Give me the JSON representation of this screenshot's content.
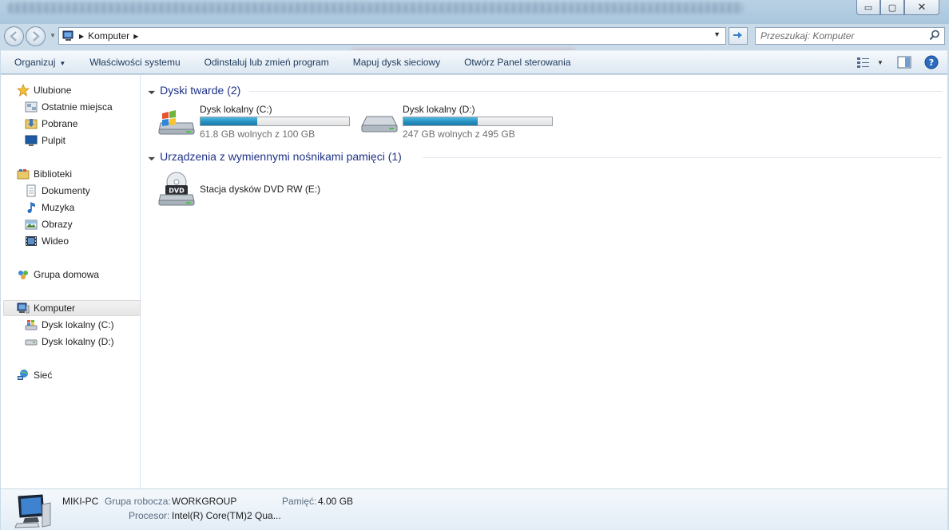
{
  "window": {
    "minimize_label": "▭",
    "maximize_label": "▢",
    "close_label": "✕"
  },
  "address": {
    "breadcrumb": "Komputer"
  },
  "search": {
    "placeholder": "Przeszukaj: Komputer"
  },
  "toolbar": {
    "organize": "Organizuj",
    "system_properties": "Właściwości systemu",
    "uninstall": "Odinstaluj lub zmień program",
    "map_drive": "Mapuj dysk sieciowy",
    "control_panel": "Otwórz Panel sterowania"
  },
  "nav": {
    "favorites": "Ulubione",
    "recent": "Ostatnie miejsca",
    "downloads": "Pobrane",
    "desktop": "Pulpit",
    "libraries": "Biblioteki",
    "documents": "Dokumenty",
    "music": "Muzyka",
    "pictures": "Obrazy",
    "video": "Wideo",
    "homegroup": "Grupa domowa",
    "computer": "Komputer",
    "drive_c": "Dysk lokalny (C:)",
    "drive_d": "Dysk lokalny (D:)",
    "network": "Sieć"
  },
  "groups": {
    "hard_disks": "Dyski twarde (2)",
    "removable": "Urządzenia z wymiennymi nośnikami pamięci (1)"
  },
  "drives": [
    {
      "name": "Dysk lokalny (C:)",
      "free_text": "61.8 GB wolnych z 100 GB",
      "used_fraction": 0.38
    },
    {
      "name": "Dysk lokalny (D:)",
      "free_text": "247 GB wolnych z 495 GB",
      "used_fraction": 0.5
    }
  ],
  "dvd": {
    "name": "Stacja dysków DVD RW (E:)",
    "icon_text": "DVD"
  },
  "details": {
    "pc_name": "MIKI-PC",
    "workgroup_label": "Grupa robocza:",
    "workgroup_value": "WORKGROUP",
    "memory_label": "Pamięć:",
    "memory_value": "4.00 GB",
    "processor_label": "Procesor:",
    "processor_value": "Intel(R) Core(TM)2 Qua..."
  },
  "colors": {
    "accent": "#1e3287",
    "progress": "#268fbf"
  }
}
